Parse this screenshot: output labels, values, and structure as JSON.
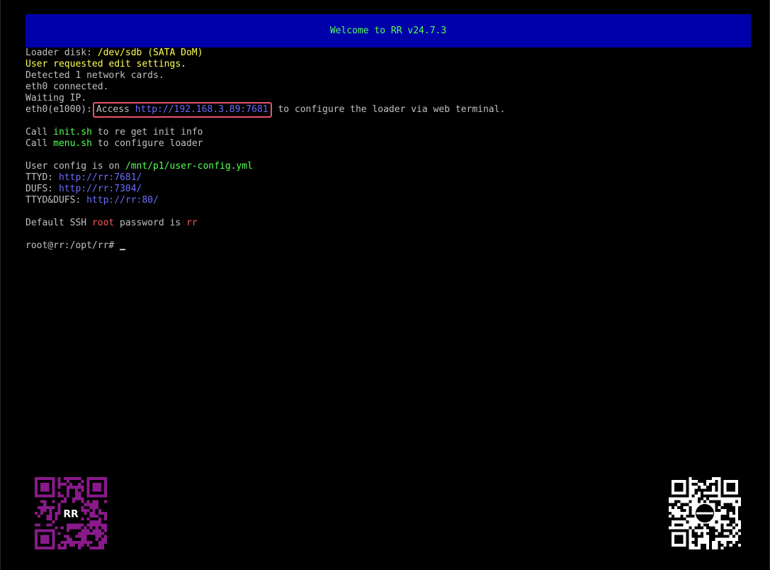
{
  "title": "Welcome to RR v24.7.3",
  "lines": {
    "loader_disk_label": "Loader disk: ",
    "loader_disk_value": "/dev/sdb (SATA DoM)",
    "user_edit": "User requested edit settings.",
    "detected": "Detected 1 network cards.",
    "eth0_connected": "eth0 connected.",
    "waiting_ip": "Waiting IP.",
    "eth0_prefix": "eth0(e1000):",
    "access_word": "Access ",
    "access_url": "http://192.168.3.89:7681",
    "access_suffix": " to configure the loader via web terminal.",
    "call1_prefix": "Call ",
    "call1_cmd": "init.sh",
    "call1_suffix": " to re get init info",
    "call2_prefix": "Call ",
    "call2_cmd": "menu.sh",
    "call2_suffix": " to configure loader",
    "config_prefix": "User config is on ",
    "config_path": "/mnt/p1/user-config.yml",
    "ttyd_label": "TTYD: ",
    "ttyd_url": "http://rr:7681/",
    "dufs_label": "DUFS: ",
    "dufs_url": "http://rr:7304/",
    "ttyddufs_label": "TTYD&DUFS: ",
    "ttyddufs_url": "http://rr:80/",
    "ssh_prefix": "Default SSH ",
    "ssh_user": "root",
    "ssh_middle": " password is ",
    "ssh_pass": "rr",
    "prompt": "root@rr:/opt/rr# "
  },
  "qr_left_logo": "RR",
  "colors": {
    "title_bg": "#0000aa",
    "title_text": "#55ff55",
    "highlight_border": "#e5546a",
    "qr_left": "#8a1a8a"
  },
  "icons": {
    "qr_left": "qr-code-icon",
    "qr_right": "qr-code-icon"
  }
}
